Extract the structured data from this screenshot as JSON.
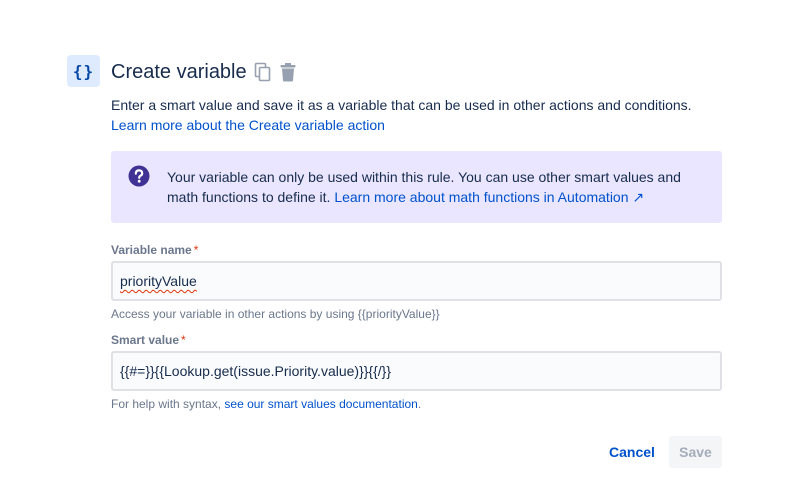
{
  "header": {
    "icon_text": "{}",
    "icon_name": "braces-icon",
    "title": "Create variable",
    "actions": [
      "copy-icon",
      "trash-icon"
    ]
  },
  "description": {
    "text": "Enter a smart value and save it as a variable that can be used in other actions and conditions.",
    "link": "Learn more about the Create variable action"
  },
  "info_panel": {
    "icon_name": "question-circle-icon",
    "text": "Your variable can only be used within this rule. You can use other smart values and math functions to define it.",
    "link": "Learn more about math functions in Automation ↗"
  },
  "variable_name": {
    "label": "Variable name",
    "required_mark": "*",
    "value": "priorityValue",
    "helper": "Access your variable in other actions by using {{priorityValue}}"
  },
  "smart_value": {
    "label": "Smart value",
    "required_mark": "*",
    "value": "{{#=}}{{Lookup.get(issue.Priority.value)}}{{/}}",
    "helper_text": "For help with syntax,",
    "helper_link": "see our smart values documentation",
    "helper_end": "."
  },
  "buttons": {
    "cancel": "Cancel",
    "save": "Save"
  },
  "colors": {
    "link": "#0052CC",
    "info_bg": "#EAE6FF",
    "info_icon": "#403294",
    "badge_bg": "#DEEBFF",
    "required": "#DE350B"
  }
}
